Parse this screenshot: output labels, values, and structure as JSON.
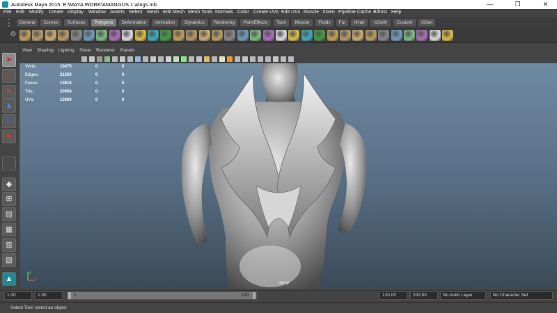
{
  "window": {
    "title": "Autodesk Maya 2015: E:\\MAYA WORK\\AMANGUS 1.wings.mb",
    "controls": [
      "—",
      "❐",
      "✕"
    ]
  },
  "menubar": [
    "File",
    "Edit",
    "Modify",
    "Create",
    "Display",
    "Window",
    "Assets",
    "Select",
    "Mesh",
    "Edit Mesh",
    "Mesh Tools",
    "Normals",
    "Color",
    "Create UVs",
    "Edit UVs",
    "Muscle",
    "XGen",
    "Pipeline Cache",
    "Bifrost",
    "Help"
  ],
  "shelf_tabs": {
    "items": [
      "General",
      "Curves",
      "Surfaces",
      "Polygons",
      "Deformation",
      "Animation",
      "Dynamics",
      "Rendering",
      "PaintEffects",
      "Toon",
      "Muscle",
      "Fluids",
      "Fur",
      "nHair",
      "nCloth",
      "Custom",
      "XGen"
    ],
    "active": "Polygons"
  },
  "shelf_icons": [
    "poly-sphere-icon",
    "poly-cube-icon",
    "poly-cylinder-icon",
    "poly-cone-icon",
    "poly-plane-icon",
    "poly-torus-icon",
    "poly-prism-icon",
    "poly-pyramid-icon",
    "poly-pipe-icon",
    "poly-helix-icon",
    "poly-soccer-ball-icon",
    "poly-platonic-icon",
    "combine-icon",
    "separate-icon",
    "extract-icon",
    "booleans-icon",
    "smooth-icon",
    "reduce-icon",
    "mirror-icon",
    "fill-hole-icon",
    "append-icon",
    "split-icon",
    "insert-loop-icon",
    "offset-loop-icon",
    "extrude-icon",
    "bridge-icon",
    "bevel-icon",
    "merge-icon",
    "sculpt-icon",
    "planar-map-icon",
    "cylindrical-map-icon",
    "spherical-map-icon",
    "auto-map-icon",
    "uv-editor-icon"
  ],
  "viewport": {
    "menu": [
      "View",
      "Shading",
      "Lighting",
      "Show",
      "Renderer",
      "Panels"
    ],
    "hud": [
      {
        "label": "Verts:",
        "values": [
          "10475",
          "0",
          "0"
        ]
      },
      {
        "label": "Edges:",
        "values": [
          "21359",
          "0",
          "0"
        ]
      },
      {
        "label": "Faces:",
        "values": [
          "10818",
          "0",
          "0"
        ]
      },
      {
        "label": "Tris:",
        "values": [
          "20954",
          "0",
          "0"
        ]
      },
      {
        "label": "UVs:",
        "values": [
          "15929",
          "0",
          "0"
        ]
      }
    ],
    "camera": "persp",
    "axis": {
      "y": "y",
      "x": "x"
    }
  },
  "timeline": {
    "current_start": "1.00",
    "start": "1.00",
    "range_low": "1",
    "range_high": "120",
    "end": "120.00",
    "anim_end": "200.00",
    "anim_layer": "No Anim Layer",
    "character_set": "No Character Set"
  },
  "helpline": "Select Tool: select an object",
  "colors": {
    "viewport_top": "#6f8aa3",
    "viewport_bottom": "#3b4a58",
    "ui_bg": "#444444",
    "active_tab": "#7a7a7a"
  }
}
